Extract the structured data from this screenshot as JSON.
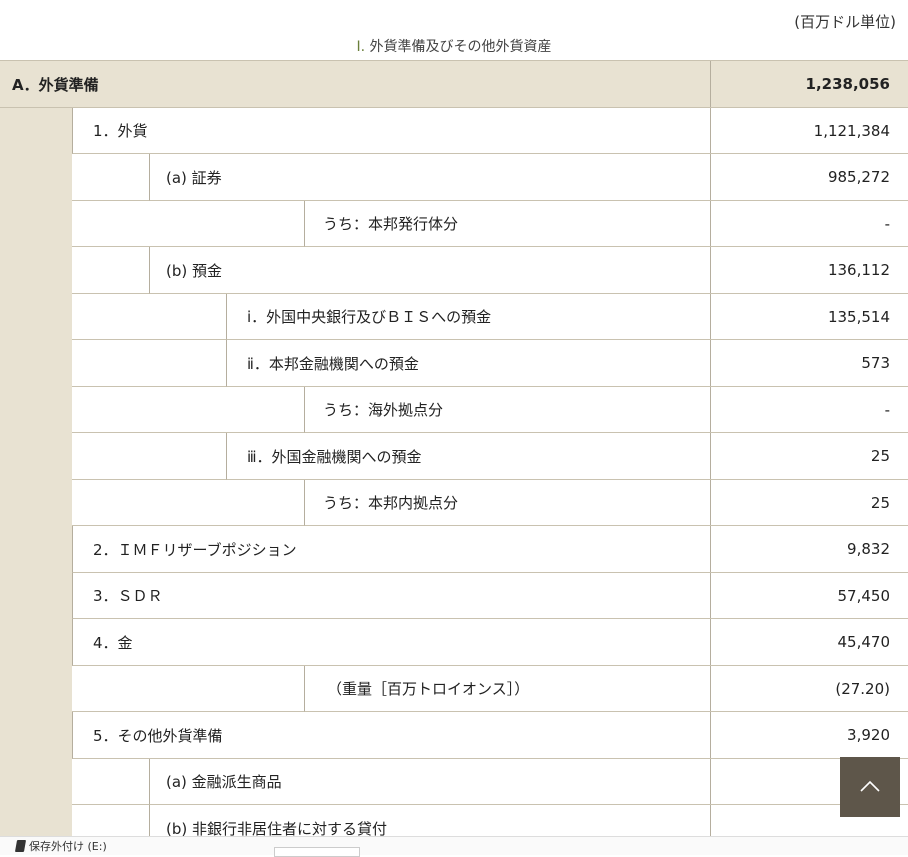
{
  "unit_label": "(百万ドル単位)",
  "caption": {
    "number": "Ⅰ.",
    "title": "外貨準備及びその他外貨資産"
  },
  "rows": [
    {
      "label": "A．外貨準備",
      "value": "1,238,056"
    },
    {
      "label": "1．外貨",
      "value": "1,121,384"
    },
    {
      "label": "(a) 証券",
      "value": "985,272"
    },
    {
      "label": "うち：本邦発行体分",
      "value": "-"
    },
    {
      "label": "(b) 預金",
      "value": "136,112"
    },
    {
      "label": "ⅰ．外国中央銀行及びＢＩＳへの預金",
      "value": "135,514"
    },
    {
      "label": "ⅱ．本邦金融機関への預金",
      "value": "573"
    },
    {
      "label": "うち：海外拠点分",
      "value": "-"
    },
    {
      "label": "ⅲ．外国金融機関への預金",
      "value": "25"
    },
    {
      "label": "うち：本邦内拠点分",
      "value": "25"
    },
    {
      "label": "2．ＩＭＦリザーブポジション",
      "value": "9,832"
    },
    {
      "label": "3．ＳＤＲ",
      "value": "57,450"
    },
    {
      "label": "4．金",
      "value": "45,470"
    },
    {
      "label": "（重量［百万トロイオンス］）",
      "value": "(27.20)"
    },
    {
      "label": "5．その他外貨準備",
      "value": "3,920"
    },
    {
      "label": "(a) 金融派生商品",
      "value": ""
    },
    {
      "label": "(b) 非銀行非居住者に対する貸付",
      "value": ""
    }
  ],
  "taskbar": {
    "drive_label": "保存外付け (E:)"
  },
  "icons": {
    "back_to_top": "chevron-up-icon",
    "drive": "usb-drive-icon"
  },
  "colors": {
    "header_band": "#e8e2d2",
    "border": "#c9c2b0",
    "back_to_top_bg": "#5e564a"
  }
}
